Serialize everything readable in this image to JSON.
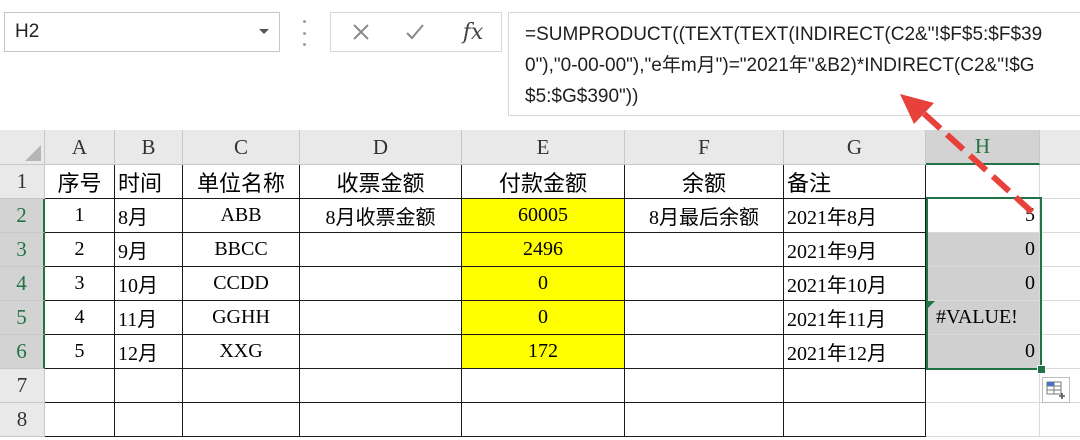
{
  "name_box": {
    "value": "H2"
  },
  "formula_bar": {
    "formula": "=SUMPRODUCT((TEXT(TEXT(INDIRECT(C2&\"!$F$5:$F$390\"),\"0-00-00\"),\"e年m月\")=\"2021年\"&B2)*INDIRECT(C2&\"!$G$5:$G$390\"))",
    "fx_label": "fx"
  },
  "columns": [
    "A",
    "B",
    "C",
    "D",
    "E",
    "F",
    "G",
    "H"
  ],
  "rows": [
    "1",
    "2",
    "3",
    "4",
    "5",
    "6",
    "7",
    "8"
  ],
  "header_row": [
    "序号",
    "时间",
    "单位名称",
    "收票金额",
    "付款金额",
    "余额",
    "备注",
    ""
  ],
  "data_rows": [
    [
      "1",
      "8月",
      "ABB",
      "8月收票金额",
      "60005",
      "8月最后余额",
      "2021年8月",
      "5"
    ],
    [
      "2",
      "9月",
      "BBCC",
      "",
      "2496",
      "",
      "2021年9月",
      "0"
    ],
    [
      "3",
      "10月",
      "CCDD",
      "",
      "0",
      "",
      "2021年10月",
      "0"
    ],
    [
      "4",
      "11月",
      "GGHH",
      "",
      "0",
      "",
      "2021年11月",
      "#VALUE!"
    ],
    [
      "5",
      "12月",
      "XXG",
      "",
      "172",
      "",
      "2021年12月",
      "0"
    ]
  ],
  "colors": {
    "selection": "#217346",
    "highlight": "#ffff00",
    "annotation_arrow": "#e8413c"
  },
  "icons": {
    "cancel": "x-icon",
    "enter": "check-icon",
    "quick_analysis": "quick-analysis-icon",
    "name_box_dropdown": "chevron-down-icon"
  }
}
